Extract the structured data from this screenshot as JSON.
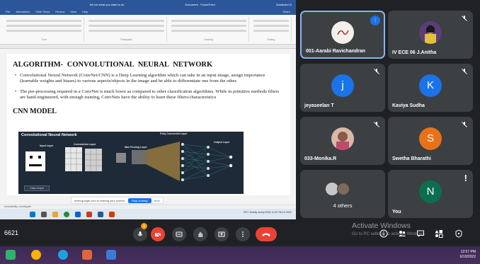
{
  "ppt": {
    "title": "Document - PowerPoint",
    "search_hint": "Tell me what you want to do",
    "user": "Gowthami G",
    "share_label": "Share",
    "tabs": [
      "File",
      "Animations",
      "Slide Show",
      "Review",
      "View",
      "Help"
    ],
    "group_captions": [
      "Font",
      "Paragraph",
      "Drawing",
      "Editing"
    ],
    "status_left": "Accessibility: Investigate",
    "slide": {
      "heading": "ALGORITHM- CONVOLUTIONAL NEURAL    NETWORK",
      "bullet1": "Convolutional Neural Network (ConvNet/CNN) is a Deep Learning algorithm which can take in an input image, assign importance (learnable weights and biases) to various aspects/objects in the image and be able to differentiate one from the other.",
      "bullet2": "The pre-processing required in a ConvNet is much lower as compared to other classification algorithms. While in primitive methods filters are hand-engineered, with enough training, ConvNets have the ability to learn these filters/characteristics",
      "subheading": "CNN MODEL"
    },
    "diagram": {
      "title": "Convolutional Neural Network",
      "input": "Input Layer",
      "conv": "Convolution Layer",
      "pool": "Max Pooling Layer",
      "fc": "Fully Connected Layer",
      "output": "Output Layer",
      "button": "Class Output"
    }
  },
  "sharebar": {
    "message": "meet.google.com is sharing your screen.",
    "stop_label": "Stop sharing",
    "hide_label": "Hide"
  },
  "inner_taskbar": {
    "weather": "33°C  Mostly sunny",
    "lang": "ENG",
    "time": "12:57",
    "date": "06-10-2022"
  },
  "tiles": [
    {
      "name": "001-Aarabi Ravichandran"
    },
    {
      "name": "IV ECE 06 J.Anitha"
    },
    {
      "name": "jeyaseelan T",
      "initial": "j",
      "color": "#1a73e8"
    },
    {
      "name": "Kaviya Sudha",
      "initial": "K",
      "color": "#1a73e8"
    },
    {
      "name": "033-Monika.R"
    },
    {
      "name": "Swetha Bharathi",
      "initial": "S",
      "color": "#e8711a"
    },
    {
      "name": "4 others"
    },
    {
      "name": "You",
      "initial": "N",
      "color": "#0b6e4f"
    }
  ],
  "meeting": {
    "code": "6621",
    "mic_badge": "1",
    "watermark_title": "Activate Windows",
    "watermark_sub": "Go to PC settings to activate Windows."
  },
  "clock": {
    "time": "12:57 PM",
    "date": "6/10/2022"
  }
}
